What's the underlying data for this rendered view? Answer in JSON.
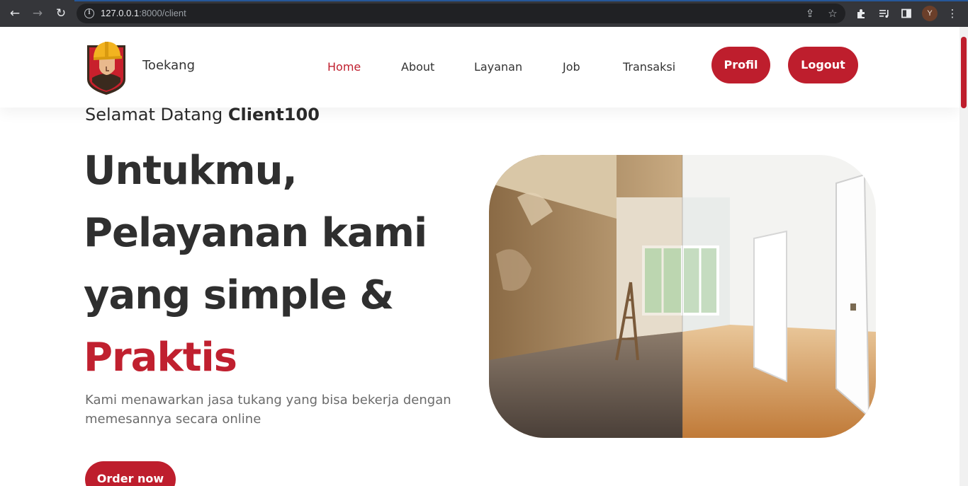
{
  "browser": {
    "url_host": "127.0.0.1",
    "url_rest": ":8000/client",
    "profile_initial": "Y",
    "icons": [
      "back-icon",
      "forward-icon",
      "reload-icon",
      "info-icon",
      "share-icon",
      "bookmark-star-icon",
      "extensions-icon",
      "media-icon",
      "side-panel-icon",
      "menu-icon"
    ]
  },
  "navbar": {
    "brand": "Toekang",
    "links": [
      "Home",
      "About",
      "Layanan",
      "Job",
      "Transaksi"
    ],
    "active": "Home",
    "profile_button": "Profil",
    "logout_button": "Logout"
  },
  "hero": {
    "welcome_prefix": "Selamat Datang",
    "username": "Client100",
    "headline_lines": [
      "Untukmu,",
      "Pelayanan kami",
      "yang simple &"
    ],
    "headline_accent": "Praktis",
    "description": "Kami menawarkan jasa tukang yang bisa bekerja dengan memesannya secara online",
    "cta": "Order now"
  },
  "colors": {
    "accent": "#be1e2d",
    "heading": "#2f2f2f",
    "muted": "#6b6b6b"
  }
}
